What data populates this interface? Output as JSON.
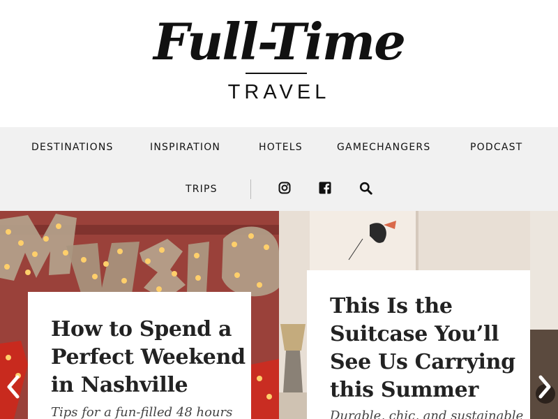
{
  "logo": {
    "title": "Full-Time",
    "subtitle": "TRAVEL"
  },
  "nav": {
    "items": [
      "DESTINATIONS",
      "INSPIRATION",
      "HOTELS",
      "GAMECHANGERS",
      "PODCAST",
      "TRIPS"
    ],
    "icons": [
      "instagram-icon",
      "facebook-icon",
      "search-icon"
    ]
  },
  "carousel": {
    "slides": [
      {
        "title_lines": [
          "How to Spend a",
          "Perfect Weekend",
          "in Nashville"
        ],
        "subtitle": "Tips for a fun-filled 48 hours"
      },
      {
        "title_lines": [
          "This Is the",
          "Suitcase You’ll",
          "See Us Carrying",
          "this Summer"
        ],
        "subtitle": "Durable, chic, and sustainable"
      }
    ],
    "prev_icon": "chevron-left-icon",
    "next_icon": "chevron-right-icon"
  },
  "colors": {
    "nav_bg": "#f1f1f1",
    "text": "#111111",
    "card_bg": "#ffffff"
  }
}
